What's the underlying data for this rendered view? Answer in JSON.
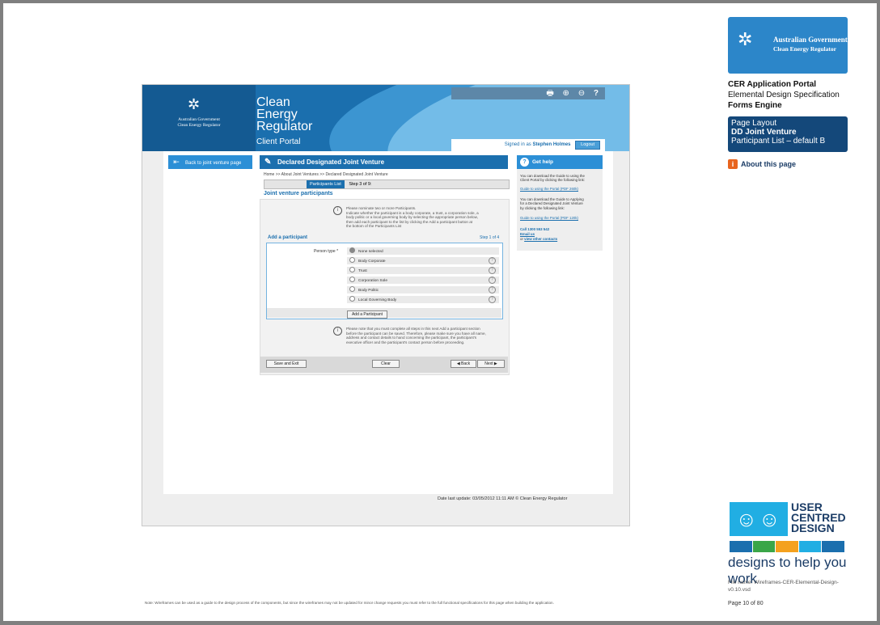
{
  "header": {
    "gov_name_line1": "Australian Government",
    "gov_name_line2": "Clean Energy Regulator",
    "brand_line1": "Clean",
    "brand_line2": "Energy",
    "brand_line3": "Regulator",
    "brand_sub": "Client Portal",
    "toolbar_icons": [
      "print-icon",
      "zoom-in-icon",
      "zoom-out-icon",
      "help-icon"
    ],
    "signed_in_prefix": "Signed in as",
    "user": "Stephen Holmes",
    "logout": "Logout"
  },
  "back_button": "Back to joint venture page",
  "main": {
    "title": "Declared Designated Joint Venture",
    "breadcrumb": "Home >> About Joint Ventures >> Declared Designated Joint Venture",
    "tab_active": "Participants List",
    "tab_step": "Step 3 of 9:",
    "section_title": "Joint venture participants",
    "info1_line1": "Please nominate two or more Participants.",
    "info1_line2": "Indicate whether the participant is a body corporate, a trust, a corporation sole, a",
    "info1_line3": "body politic or a local governing body by selecting the appropriate person below,",
    "info1_line4": "then add each participant to the list by clicking the Add a participant button at",
    "info1_line5": "the bottom of the Participants List",
    "add_title": "Add a participant",
    "add_step": "Step 1 of 4",
    "person_type_label": "Person type *",
    "options": [
      "None selected",
      "Body Corporate",
      "Trust",
      "Corporation Sole",
      "Body Politic",
      "Local Governing Body"
    ],
    "add_button": "Add a Participant",
    "info2_line1": "Please note that you must complete all steps in this next Add a participant section",
    "info2_line2": "before the participant can be saved. Therefore, please make sure you have all name,",
    "info2_line3": "address and contact details to hand concerning the participant, the participant's",
    "info2_line4": "executive officer and the participant's contact person before proceeding.",
    "save_exit": "Save and Exit",
    "clear": "Clear",
    "back": "◀ Back",
    "next": "Next ▶"
  },
  "help": {
    "title": "Get help",
    "p1_line1": "You can download the Guide to using the",
    "p1_line2": "Client Portal by clicking the following link:",
    "p1_link": "Guide to using the Portal (PDF 260k)",
    "p2_line1": "You can download the Guide to Applying",
    "p2_line2": "for a Declared Designated Joint Venture",
    "p2_line3": "by clicking the following link:",
    "p2_link": "Guide to using the Portal (PDF 120k)",
    "call": "Call 1300 553 542",
    "email": "Email us",
    "or": "or",
    "contacts": "view other contacts"
  },
  "footer": {
    "date": "Date last update: 03/05/2012 11:11 AM    © Clean Energy Regulator"
  },
  "spec": {
    "gov_line1": "Australian Government",
    "gov_line2": "Clean Energy Regulator",
    "title1": "CER Application Portal",
    "title2": "Elemental Design Specification",
    "title3": "Forms Engine",
    "layout1": "Page Layout",
    "layout2": "DD Joint Venture",
    "layout3": "Participant List – default B",
    "about": "About this page",
    "ucd1": "USER",
    "ucd2": "CENTRED",
    "ucd3": "DESIGN",
    "tagline": "designs to help you work",
    "filename": "File name: Wireframes-CER-Elemental-Design-v0.10.vsd",
    "page": "Page 10 of 80",
    "note": "Note: Wireframes can be used as a guide to the design process of the components, but since the wireframes may not be updated for minor change requests you must refer to the full functional specifications for this page when building the application."
  },
  "colors": {
    "brand_blue": "#1b6fae",
    "accent_blue": "#2c8fd6",
    "navy": "#14487a",
    "orange": "#e8641e",
    "ucd_bars": [
      "#1b6fae",
      "#3aa648",
      "#f4a11e",
      "#21aee3",
      "#1b6fae"
    ]
  }
}
